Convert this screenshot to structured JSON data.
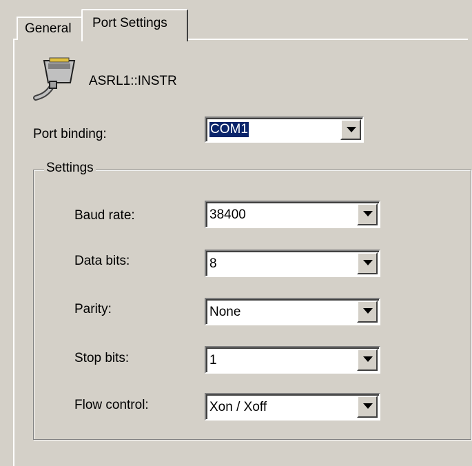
{
  "tabs": [
    {
      "label": "General"
    },
    {
      "label": "Port Settings"
    }
  ],
  "resource": {
    "name": "ASRL1::INSTR",
    "icon": "serial-connector-icon"
  },
  "port_binding": {
    "label": "Port binding:",
    "value": "COM1"
  },
  "settings": {
    "title": "Settings",
    "fields": [
      {
        "label": "Baud rate:",
        "value": "38400"
      },
      {
        "label": "Data bits:",
        "value": "8"
      },
      {
        "label": "Parity:",
        "value": "None"
      },
      {
        "label": "Stop bits:",
        "value": "1"
      },
      {
        "label": "Flow control:",
        "value": "Xon / Xoff"
      }
    ]
  },
  "colors": {
    "background": "#d4d0c8",
    "selection": "#0a246a"
  }
}
